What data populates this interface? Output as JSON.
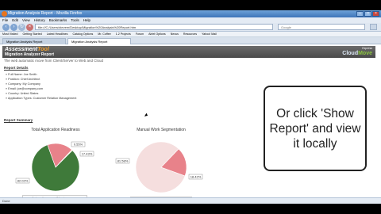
{
  "window": {
    "title": "Migration Analysis Report - Mozilla Firefox"
  },
  "menu": [
    "File",
    "Edit",
    "View",
    "History",
    "Bookmarks",
    "Tools",
    "Help"
  ],
  "address": {
    "url": "file:///C:/Users/stevem/Desktop/Migration%20Analysis%20Report.htm",
    "search_placeholder": "Google"
  },
  "bookmarks": [
    "Most Visited",
    "Getting Started",
    "Latest Headlines",
    "Catalog Options",
    "Mr. Coffee",
    "1.2 Projects",
    "Forum",
    "Airtel Options",
    "Nexus",
    "Resources",
    "Yahoo! Mail"
  ],
  "tabs": [
    "Migration Analysis Report",
    "Migration Analysis Report"
  ],
  "report": {
    "brand_line1": "Assessment",
    "brand_line1_accent": "Tool",
    "brand_line2": "Migration Analyzer Report",
    "vendor_small": "Express",
    "vendor_big": "Cloud",
    "vendor_big_accent": "Move",
    "subtitle": "The web automatic move from Client/Server to Web and Cloud",
    "details_title": "Report Details",
    "details": [
      "» Full Name:  Joe Smith",
      "» Position:  Chief Architect",
      "» Company:  My Company",
      "» Email:  joe@company.com",
      "» Country:  United States",
      "» Application Types:  Customer Relation Management"
    ],
    "summary_title": "Report Summary"
  },
  "colors": {
    "automatic": "#3f7a3a",
    "manual": "#e8828a",
    "warnings": "#f1efb0",
    "low": "#f5dede",
    "medium": "#e8828a"
  },
  "chart_data": [
    {
      "type": "pie",
      "title": "Total Application Readiness",
      "series": [
        {
          "name": "Automatic",
          "values": [
            82.02
          ]
        },
        {
          "name": "Manual",
          "values": [
            17.43
          ]
        },
        {
          "name": "Warnings",
          "values": [
            0.55
          ]
        }
      ],
      "data_labels": [
        "0.55%",
        "17.43%",
        "82.02%"
      ],
      "legend": "bottom"
    },
    {
      "type": "pie",
      "title": "Manual Work Segmentation",
      "series": [
        {
          "name": "Low",
          "values": [
            81.58
          ]
        },
        {
          "name": "Medium",
          "values": [
            18.42
          ]
        }
      ],
      "data_labels": [
        "81.58%",
        "18.42%"
      ],
      "legend": "bottom"
    }
  ],
  "callout": {
    "text": "Or click 'Show Report' and view it locally"
  },
  "status": {
    "text": "Done"
  }
}
